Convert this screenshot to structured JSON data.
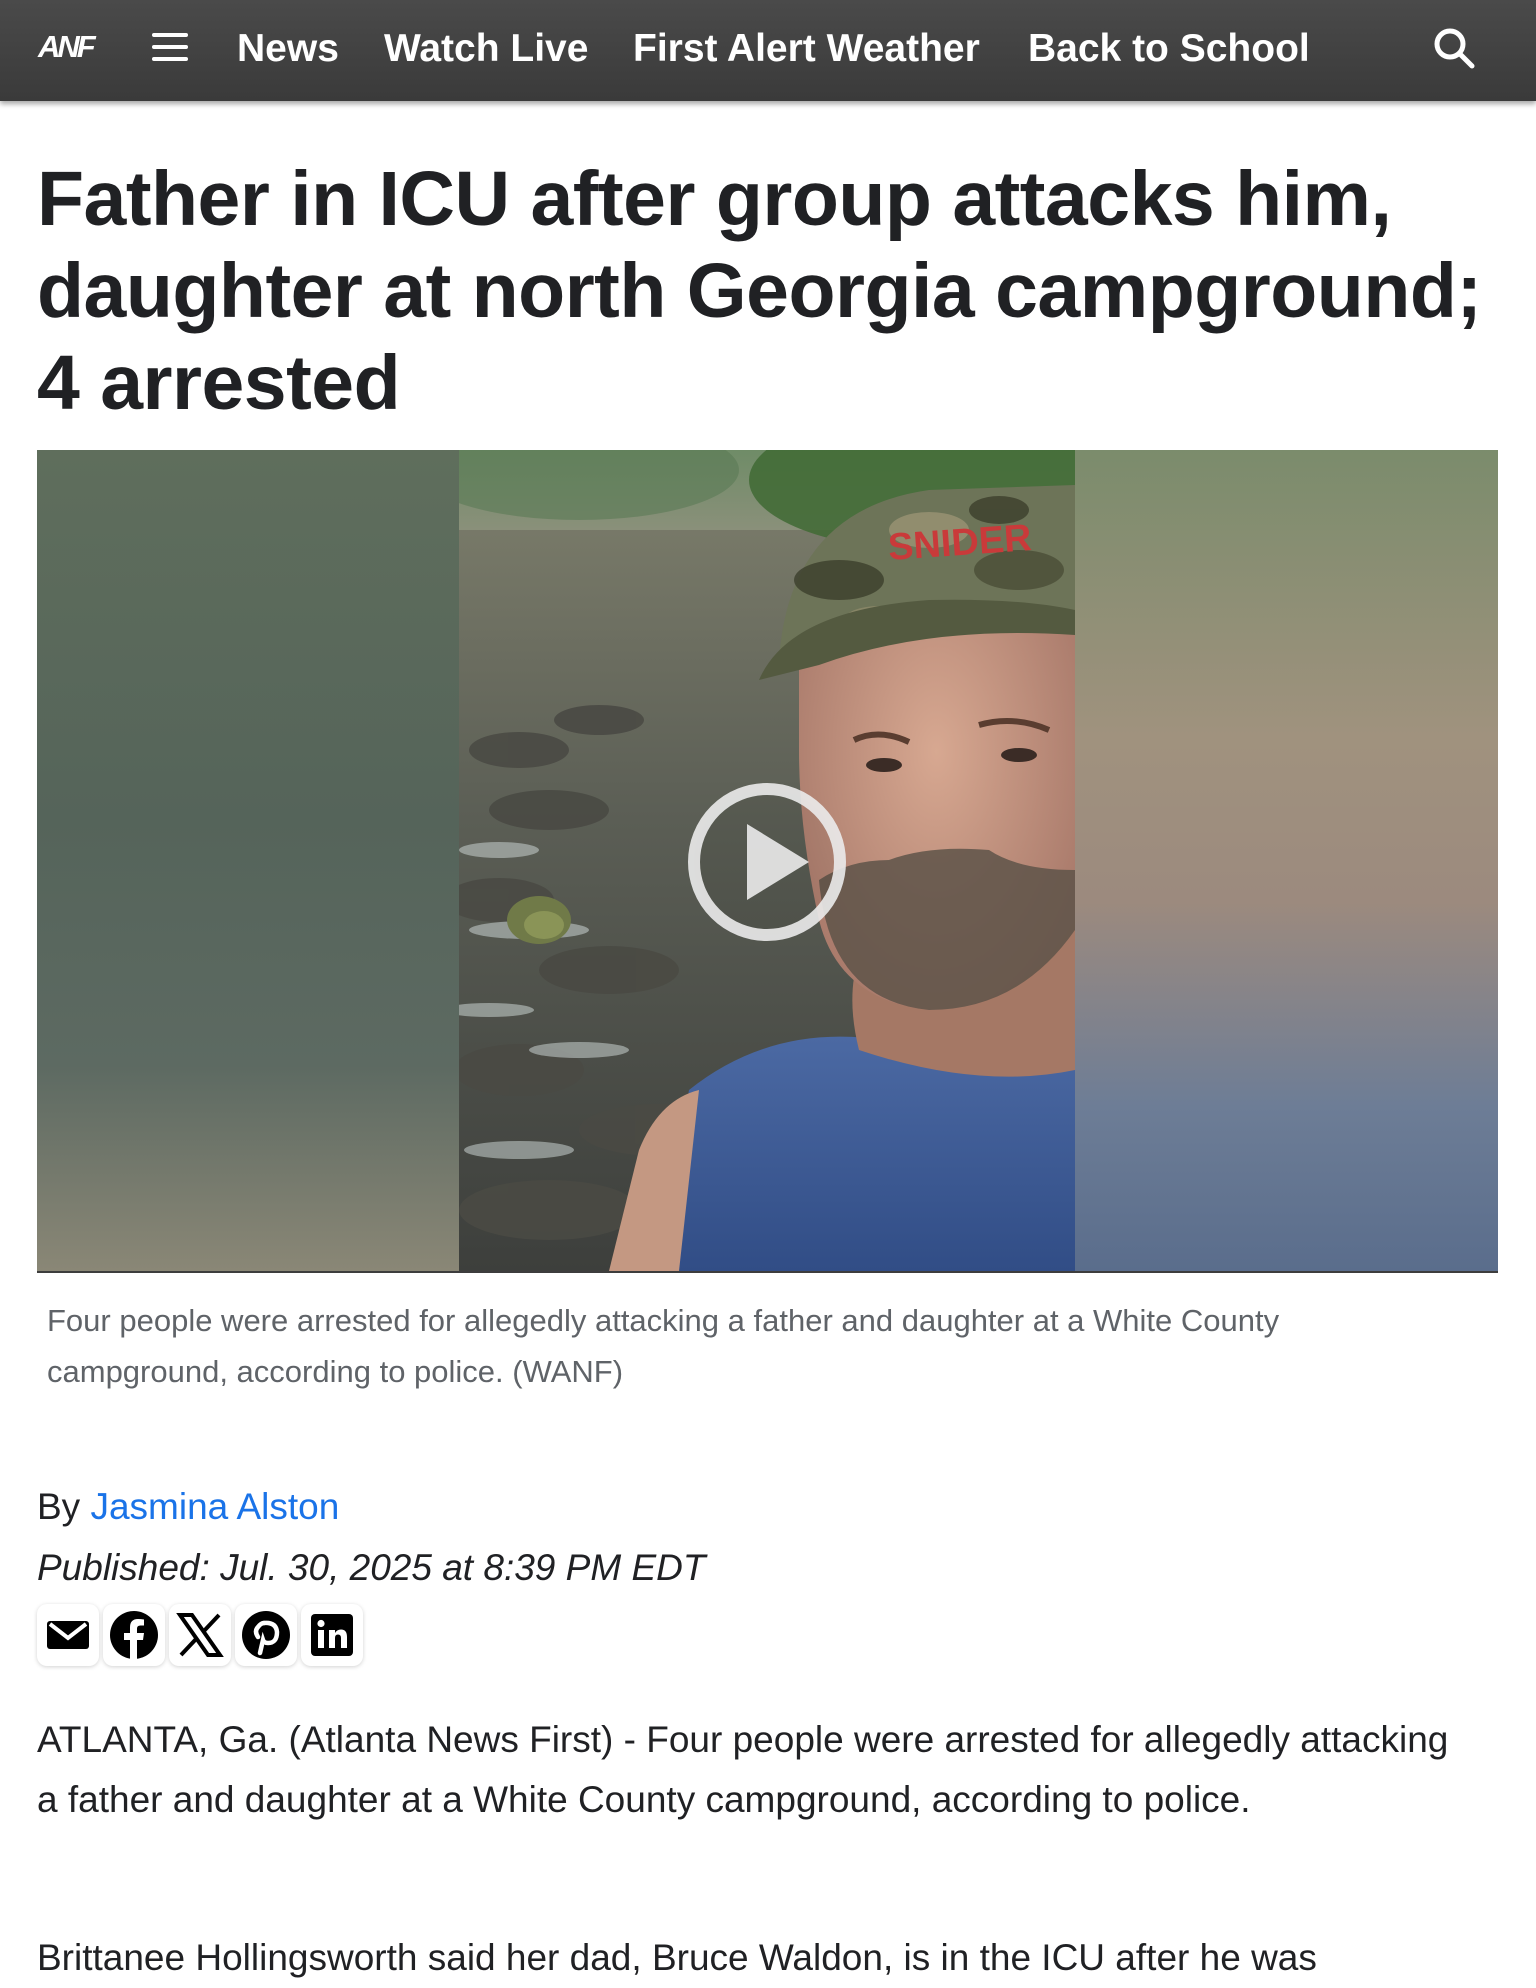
{
  "nav": {
    "logo_text": "ANF",
    "links": [
      "News",
      "Watch Live",
      "First Alert Weather",
      "Back to School"
    ]
  },
  "article": {
    "headline": "Father in ICU after group attacks him, daughter at north Georgia campground; 4 arrested",
    "caption": "Four people were arrested for allegedly attacking a father and daughter at a White County campground, according to police. (WANF)",
    "byline_prefix": "By",
    "author": "Jasmina Alston",
    "published": "Published: Jul. 30, 2025 at 8:39 PM EDT",
    "share_icons": [
      "email-icon",
      "facebook-icon",
      "x-icon",
      "pinterest-icon",
      "linkedin-icon"
    ],
    "paragraphs": [
      "ATLANTA, Ga. (Atlanta News First) - Four people were arrested for allegedly attacking a father and daughter at a White County campground, according to police.",
      "Brittanee Hollingsworth said her dad, Bruce Waldon, is in the ICU after he was"
    ]
  },
  "colors": {
    "nav_background": "#3f3f3f",
    "link_blue": "#1a73e8",
    "text": "#202124",
    "caption": "#5f6368"
  }
}
